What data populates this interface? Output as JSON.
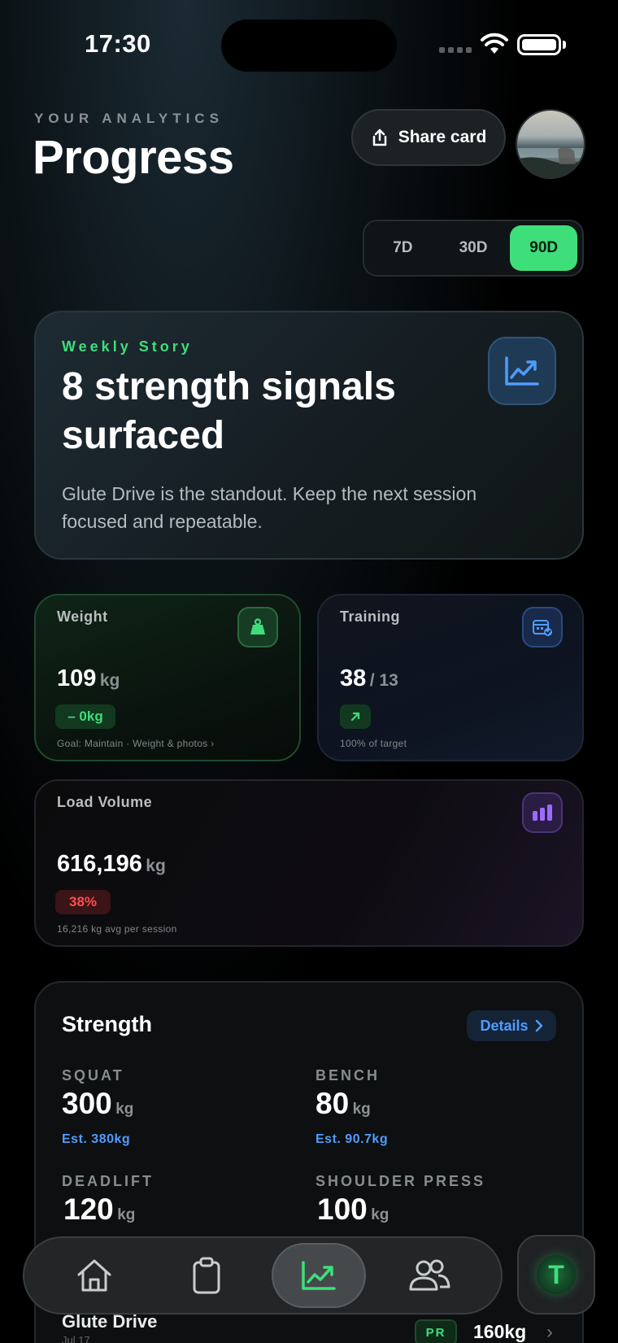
{
  "status_bar": {
    "time": "17:30"
  },
  "header": {
    "eyebrow": "YOUR ANALYTICS",
    "title": "Progress",
    "share_label": "Share card"
  },
  "range": {
    "options": [
      "7D",
      "30D",
      "90D"
    ],
    "selected": "90D"
  },
  "story": {
    "eyebrow": "Weekly Story",
    "title": "8 strength signals surfaced",
    "body": "Glute Drive is the standout. Keep the next session focused and repeatable."
  },
  "metrics": {
    "weight": {
      "label": "Weight",
      "value": "109",
      "unit": "kg",
      "delta": "– 0kg",
      "footer": "Goal: Maintain · Weight & photos ›"
    },
    "training": {
      "label": "Training",
      "value": "38",
      "target": "/ 13",
      "trend_icon": "arrow-up-right-icon",
      "footer": "100% of target"
    },
    "load": {
      "label": "Load Volume",
      "value": "616,196",
      "unit": "kg",
      "delta": "38%",
      "footer": "16,216 kg avg per session"
    }
  },
  "strength": {
    "title": "Strength",
    "details_label": "Details",
    "lifts": [
      {
        "name": "SQUAT",
        "value": "300",
        "unit": "kg",
        "est": "Est. 380kg"
      },
      {
        "name": "BENCH",
        "value": "80",
        "unit": "kg",
        "est": "Est. 90.7kg"
      },
      {
        "name": "DEADLIFT",
        "value": "120",
        "unit": "kg",
        "est": ""
      },
      {
        "name": "SHOULDER PRESS",
        "value": "100",
        "unit": "kg",
        "est": ""
      }
    ],
    "recent": {
      "title": "Glute Drive",
      "date": "Jul 17",
      "badge": "PR",
      "value": "160kg"
    }
  },
  "tabbar": {
    "tabs": [
      "home-icon",
      "clipboard-icon",
      "chart-icon",
      "people-icon"
    ],
    "active": "chart-icon",
    "brand_letter": "T"
  },
  "colors": {
    "accent_green": "#3edf7a",
    "accent_blue": "#4f9cff",
    "accent_red": "#ff4d4d",
    "accent_purple": "#9a6bff"
  }
}
